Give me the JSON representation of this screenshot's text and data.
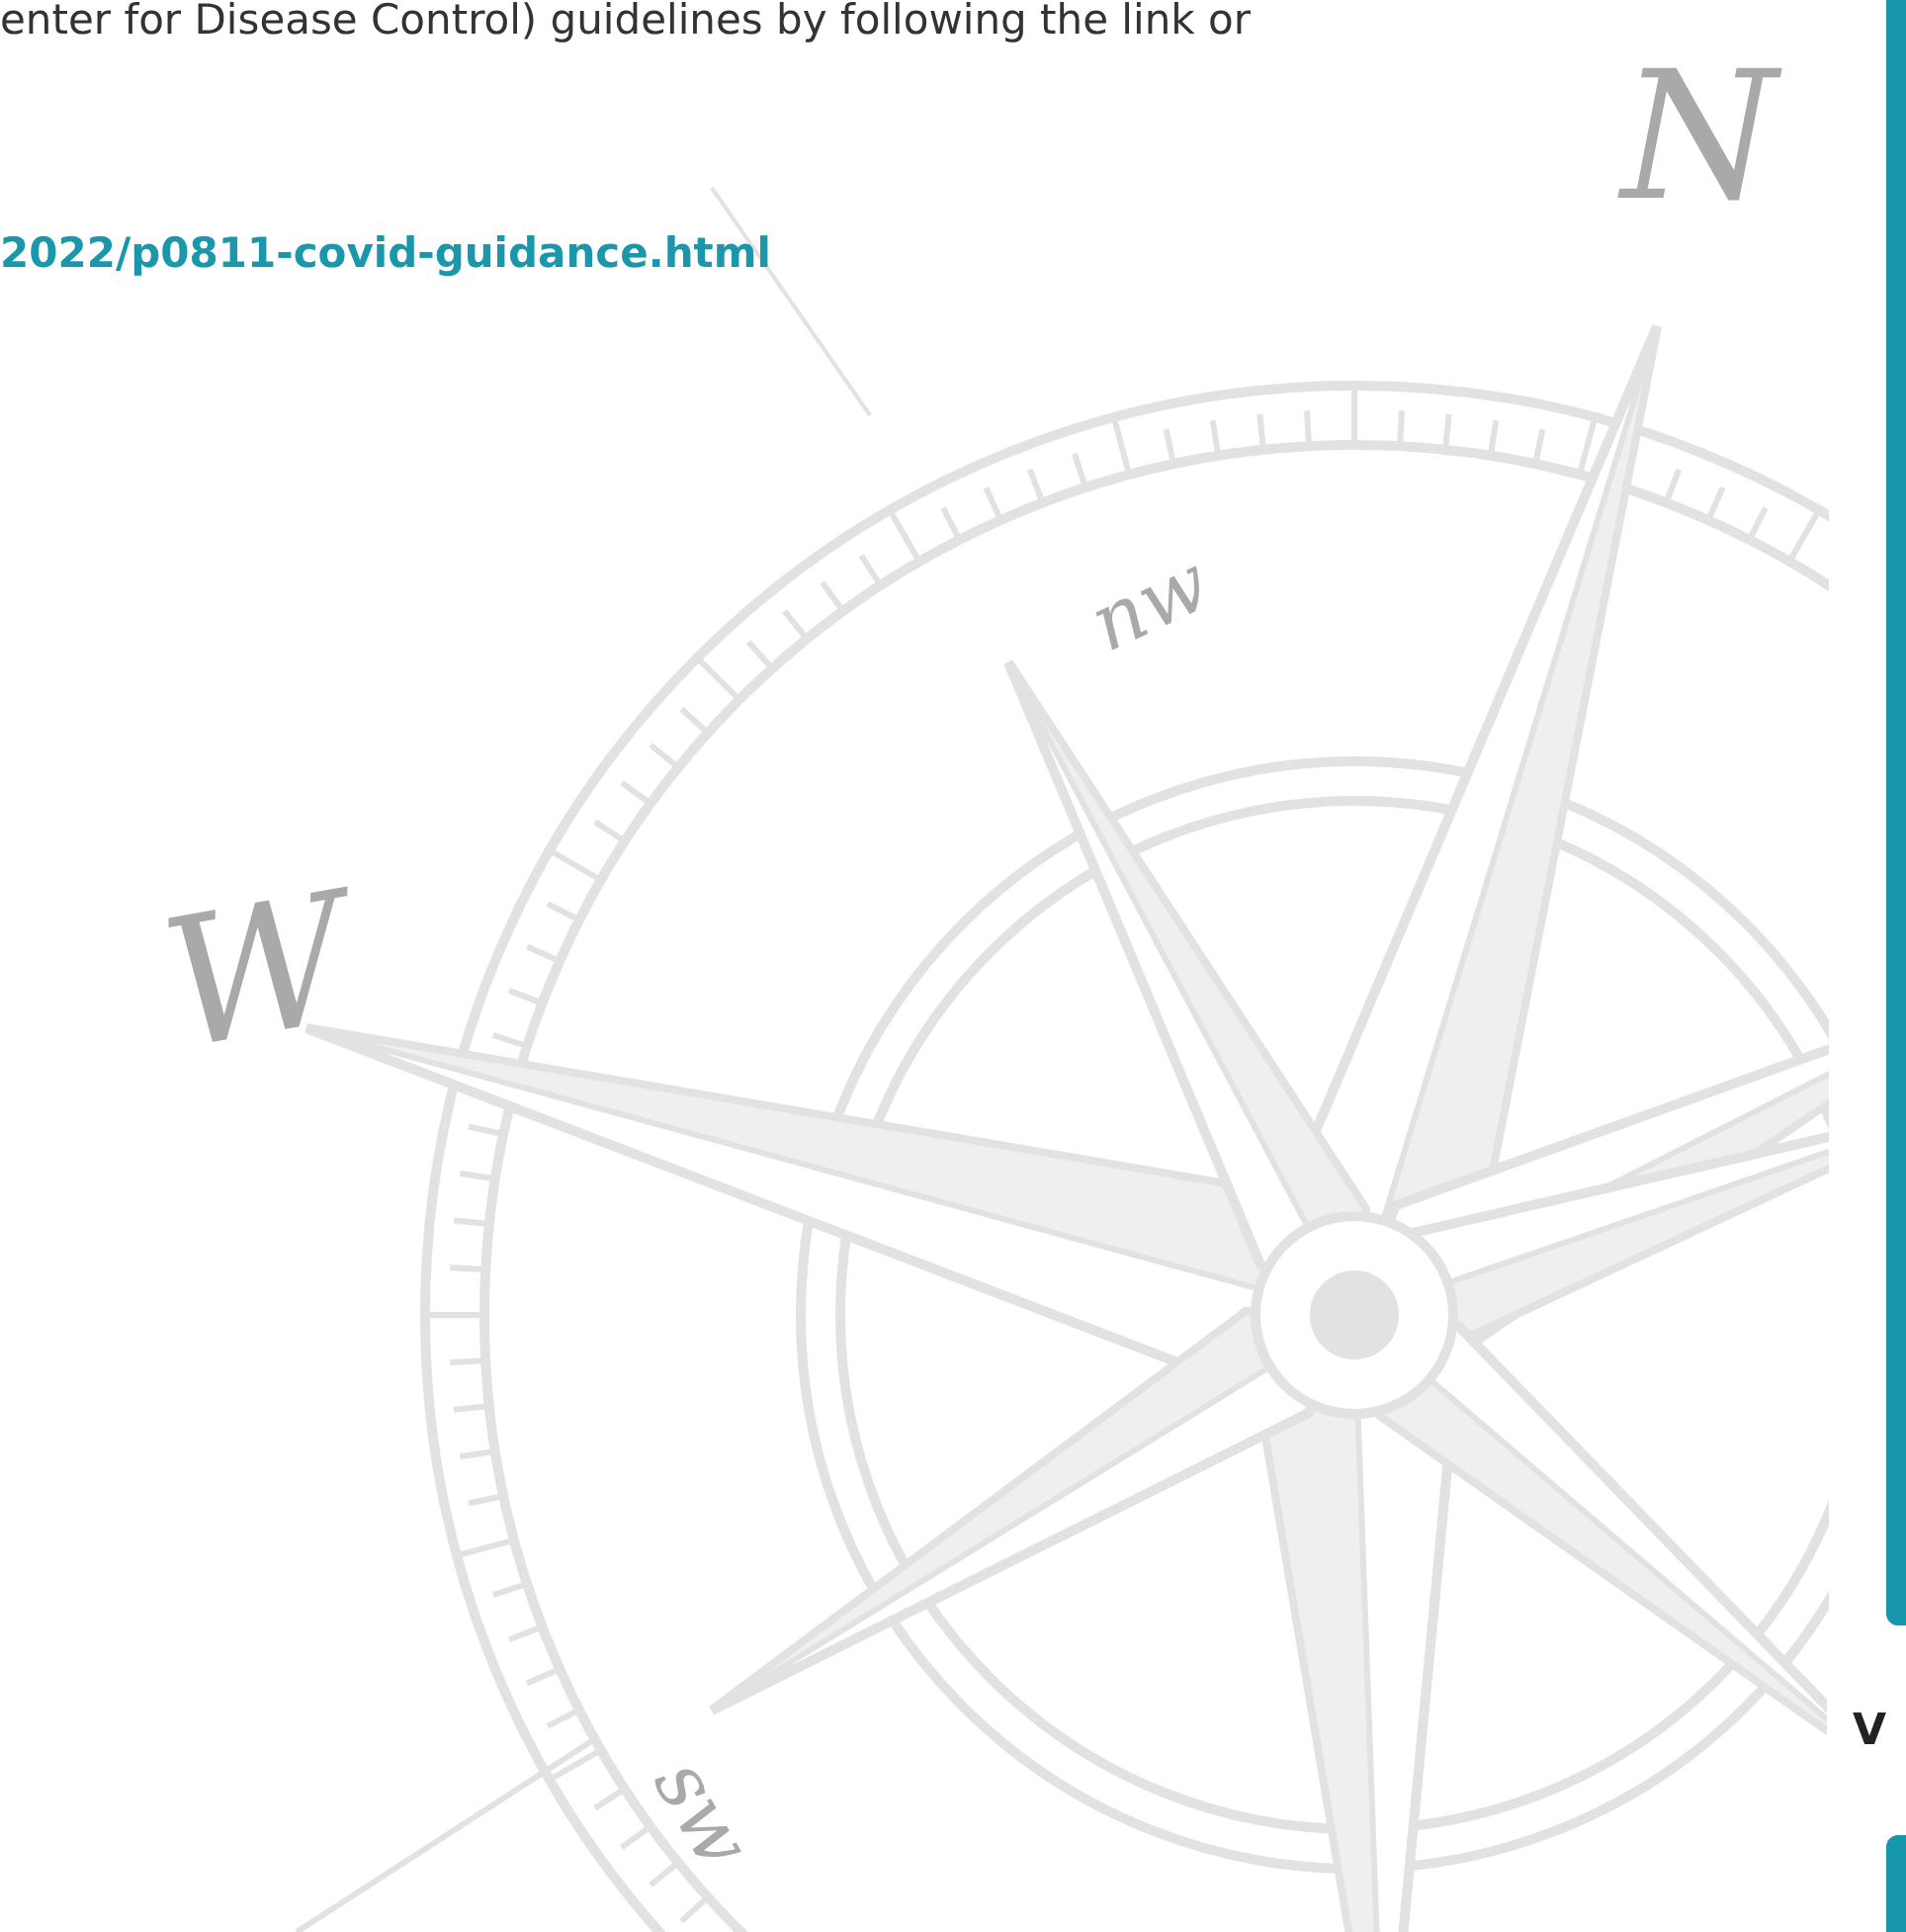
{
  "article": {
    "text": "enter for Disease Control) guidelines by following the link or",
    "link": "2022/p0811-covid-guidance.html"
  },
  "compass": {
    "labels": [
      {
        "kind": "north",
        "text": "N"
      },
      {
        "kind": "west",
        "text": "W"
      },
      {
        "kind": "northwest",
        "text": "nw"
      },
      {
        "kind": "southwest",
        "text": "sw"
      }
    ]
  },
  "side_tab": {
    "label": "V"
  }
}
